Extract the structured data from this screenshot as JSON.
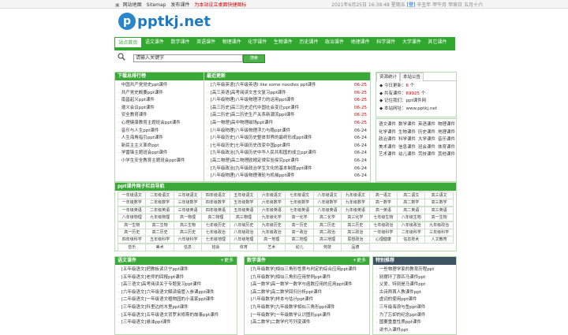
{
  "topbar": {
    "links": [
      "网站地图",
      "Sitemap",
      "发布课件"
    ],
    "promo": "为本站设立桌面快捷图标",
    "date": "2021年6月25日 16:38:48 星期五",
    "login": "[登]",
    "lunar": "辛丑年 甲午月 甲辰日 五月十六"
  },
  "logo": {
    "text": "pptkj.net",
    "badge": "p"
  },
  "nav": [
    "站点首页",
    "语文课件",
    "数学课件",
    "英语课件",
    "物理课件",
    "化学课件",
    "生物课件",
    "历史课件",
    "政治课件",
    "地理课件",
    "科学课件",
    "大学课件",
    "其它课件"
  ],
  "search": {
    "placeholder": "请输入关键字",
    "button": "搜索"
  },
  "rank": {
    "title": "下载总排行榜",
    "items": [
      "中国共产党党史ppt课件",
      "共产党史概要ppt课件",
      "南昌起义ppt课件",
      "遵义会议ppt课件",
      "安全教育课件",
      "心理健康教育主题班会ppt课件",
      "音乐与人生ppt课件",
      "人生海角指引ppt课件",
      "新民主主义革命ppt",
      "学雷锋主题班会ppt课件",
      "小学生安全教育主题班会ppt课件"
    ]
  },
  "latest": {
    "title": "最近更新",
    "items": [
      {
        "t": "[六年级英语]六年级英语I like some noodles ppt课件",
        "d": "06-25"
      },
      {
        "t": "[高三英语]高考阅读文言文复习ppt课件",
        "d": "06-25"
      },
      {
        "t": "[八年级物理]八年级物理浮力的运用ppt课件",
        "d": "06-25"
      },
      {
        "t": "[高三历史]高三历史近代中国社会变迁ppt课件",
        "d": "06-25"
      },
      {
        "t": "[高二历史]高二历史生产关系新潮流ppt课件",
        "d": "06-25"
      },
      {
        "t": "[高一物理]高中物理磁场ppt课件",
        "d": "06-25"
      },
      {
        "t": "[八年级物理]八年级物理浮力与稳ppt课件",
        "d": "06-24"
      },
      {
        "t": "[八年级历史]八年级历史整体世界的最终形成ppt课件",
        "d": "06-24"
      },
      {
        "t": "[七年级历史]七年级历史改变中国ppt课件",
        "d": "06-24"
      },
      {
        "t": "[九年级政治]九年级历史中华人民共和国的成立ppt课件",
        "d": "06-24"
      },
      {
        "t": "[高二物理]高二物理欧姆定律实验探究ppt课件",
        "d": "06-24"
      },
      {
        "t": "[九年级政治]九年级政治学生文化的基本制度ppt课件",
        "d": "06-24"
      },
      {
        "t": "[八年级物理]八年级物理滑轮与机械ppt课件",
        "d": "06-24"
      }
    ]
  },
  "stats": {
    "tabs": [
      "资源统计",
      "本站公告"
    ],
    "today_label": "今日更新：",
    "today_value": "6",
    "today_unit": "个",
    "total_label": "共有课件：",
    "total_value": "69925",
    "total_unit": "个",
    "remember_label": "记住我们：",
    "remember_value": "ppt课件网",
    "url_label": "本站网址：",
    "url_value": "www.pptkj.net"
  },
  "tags": [
    [
      "语文课件",
      "数学课件",
      "英语课件",
      "物理课件"
    ],
    [
      "化学课件",
      "生物课件",
      "历史课件",
      "地理课件"
    ],
    [
      "政治课件",
      "科学课件",
      "大学课件",
      "音乐课件"
    ],
    [
      "美术课件",
      "信息课件",
      "班会课件",
      "体育课件"
    ],
    [
      "艺术课件",
      "幼儿课件",
      "劳技课件",
      "其他课件"
    ]
  ],
  "grid": {
    "title": "ppt课件网子栏目导航",
    "rows": [
      [
        "一年级语文",
        "二年级语文",
        "三年级语文",
        "四年级语文",
        "五年级语文",
        "六年级语文",
        "七年级语文",
        "八年级语文",
        "九年级语文",
        "高一语文",
        "高二语文",
        "高三语文"
      ],
      [
        "一年级数学",
        "二年级数学",
        "三年级数学",
        "四年级数学",
        "五年级数学",
        "六年级数学",
        "七年级数学",
        "八年级数学",
        "九年级数学",
        "高一数学",
        "高二数学",
        "高三数学"
      ],
      [
        "一年级英语",
        "二年级英语",
        "三年级英语",
        "四年级英语",
        "五年级英语",
        "六年级英语",
        "七年级英语",
        "八年级英语",
        "九年级英语",
        "高一英语",
        "高二英语",
        "高三英语"
      ],
      [
        "八年级物理",
        "九年级物理",
        "高一物理",
        "高二物理",
        "高三物理",
        "九年级化学",
        "高一化学",
        "高二化学",
        "高三化学",
        "七年级生物",
        "八年级生物",
        "高一生物"
      ],
      [
        "高一生物",
        "高二生物",
        "高三生物",
        "七年级历史",
        "八年级历史",
        "九年级历史",
        "高一历史",
        "高二历史",
        "高三历史",
        "七年级政治",
        "八年级政治",
        "九年级政治"
      ],
      [
        "高一历史",
        "高二历史",
        "高三历史",
        "七年级政治",
        "八年级政治",
        "九年级政治",
        "高一政治",
        "高二政治",
        "高三政治",
        "一年级科学",
        "二年级科学",
        "三年级科学"
      ],
      [
        "四年级科学",
        "五年级科学",
        "六年级科学",
        "七年级地理",
        "八年级地理",
        "高一地理",
        "高二地理",
        "高三地理",
        "思想政治",
        "心理健康",
        "信息技术",
        "人文教育"
      ],
      [
        "音乐",
        "美术",
        "信息",
        "班会",
        "体育",
        "艺术",
        "幼儿",
        "劳技",
        "品德"
      ]
    ]
  },
  "chinese": {
    "title": "语文课件",
    "more": "+更多",
    "items": [
      "[五年级语文]把教板读贝宁ppt课件",
      "[五年级语文]老师的回报ppt课件",
      "[高三语文]高考阅读关于专题复习ppt课件",
      "[六年级语文]六年级语文解读接管入参课ppt课件",
      "[二年级语文]一年级语文植物园的小溪家ppt课件",
      "[三年级语文]科里边的木里ppt课件",
      "[五年级语文]五年级语文背罗米修斯的故事ppt课件",
      "[三年级语文]悬浊ppt课件"
    ]
  },
  "math": {
    "title": "数学课件",
    "more": "+更多",
    "items": [
      "[九年级数学]相似三角形性质与判定的综合应用ppt课件",
      "[九年级数学]相似三角形应用举例ppt课件",
      "[高一数学]高一数学一数学与函数应用的应用ppt课件",
      "[高二数学]高二数学回归分析ppt课件",
      "[八年级数学]样本与估计ppt课件",
      "[九年级数学]九年级数学相似三角形ppt课件",
      "[一年级数学]一年级数学认识图形ppt课件",
      "[高二数学]二数学代写列变课件"
    ]
  },
  "feature": {
    "title": "特别推荐",
    "items": [
      "一些物理学家的教育历程ppt",
      "别摆环了那匹马课件ppt",
      "父爱、特别是马课件ppt",
      "古诗两首人教课件ppt",
      "虚词的使用ppt课件",
      "三年级海浪与鱼ppt课件",
      "为了忘却的纪念ppt课件",
      "国要重重性质ppt课件",
      "讲书入课件ppt"
    ]
  }
}
